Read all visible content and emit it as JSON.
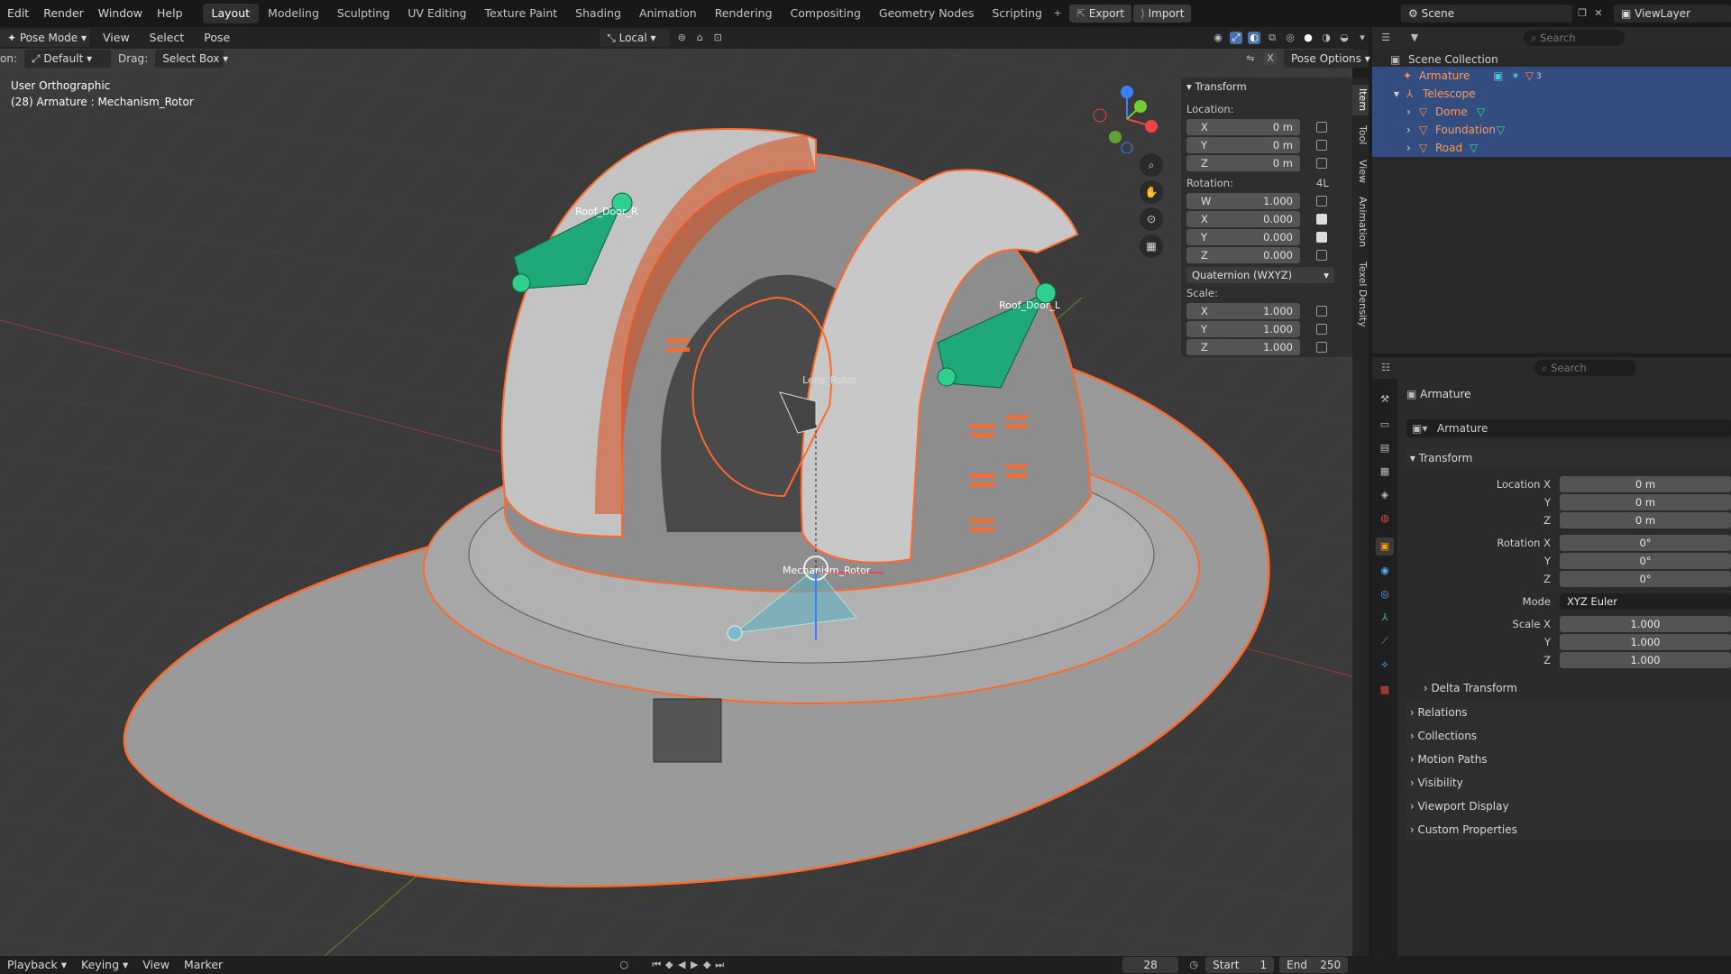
{
  "menubar": {
    "items": [
      "Edit",
      "Render",
      "Window",
      "Help"
    ],
    "workspaces": [
      "Layout",
      "Modeling",
      "Sculpting",
      "UV Editing",
      "Texture Paint",
      "Shading",
      "Animation",
      "Rendering",
      "Compositing",
      "Geometry Nodes",
      "Scripting"
    ],
    "active_workspace": "Layout",
    "export_label": "Export",
    "import_label": "Import",
    "scene_name": "Scene",
    "view_layer": "ViewLayer"
  },
  "viewport_header": {
    "mode": "Pose Mode",
    "menus": [
      "View",
      "Select",
      "Pose"
    ],
    "orientation_prefix": "on:",
    "orientation": "Default",
    "drag_label": "Drag:",
    "drag_value": "Select Box",
    "transform_space": "Local",
    "pose_options": "Pose Options"
  },
  "viewport": {
    "view_name": "User Orthographic",
    "active_info": "(28) Armature : Mechanism_Rotor",
    "bones": [
      "Roof_Door_R",
      "Roof_Door_L",
      "Lens_Rotor",
      "Mechanism_Rotor"
    ]
  },
  "npanel": {
    "title": "Transform",
    "location_label": "Location:",
    "location": [
      {
        "axis": "X",
        "value": "0 m"
      },
      {
        "axis": "Y",
        "value": "0 m"
      },
      {
        "axis": "Z",
        "value": "0 m"
      }
    ],
    "rotation_label": "Rotation:",
    "rotation_badge": "4L",
    "rotation": [
      {
        "axis": "W",
        "value": "1.000"
      },
      {
        "axis": "X",
        "value": "0.000"
      },
      {
        "axis": "Y",
        "value": "0.000"
      },
      {
        "axis": "Z",
        "value": "0.000"
      }
    ],
    "rotation_mode": "Quaternion (WXYZ)",
    "scale_label": "Scale:",
    "scale": [
      {
        "axis": "X",
        "value": "1.000"
      },
      {
        "axis": "Y",
        "value": "1.000"
      },
      {
        "axis": "Z",
        "value": "1.000"
      }
    ],
    "tabs": [
      "Item",
      "Tool",
      "View",
      "Animation",
      "Texel Density"
    ]
  },
  "outliner": {
    "search_placeholder": "Search",
    "root": "Scene Collection",
    "rows": [
      {
        "label": "Armature",
        "indent": 1,
        "selected": true
      },
      {
        "label": "Telescope",
        "indent": 1,
        "selected": true
      },
      {
        "label": "Dome",
        "indent": 2,
        "selected": true
      },
      {
        "label": "Foundation",
        "indent": 2,
        "selected": true
      },
      {
        "label": "Road",
        "indent": 2,
        "selected": true
      }
    ],
    "badge_3": "3"
  },
  "properties": {
    "search_placeholder": "Search",
    "object_name": "Armature",
    "object_field": "Armature",
    "transform_title": "Transform",
    "location_x_label": "Location X",
    "y_label": "Y",
    "z_label": "Z",
    "location": [
      "0 m",
      "0 m",
      "0 m"
    ],
    "rotation_x_label": "Rotation X",
    "rotation": [
      "0°",
      "0°",
      "0°"
    ],
    "mode_label": "Mode",
    "mode_value": "XYZ Euler",
    "scale_x_label": "Scale X",
    "scale": [
      "1.000",
      "1.000",
      "1.000"
    ],
    "delta_transform": "Delta Transform",
    "panels": [
      "Relations",
      "Collections",
      "Motion Paths",
      "Visibility",
      "Viewport Display",
      "Custom Properties"
    ]
  },
  "timeline": {
    "menus": [
      "Playback",
      "Keying",
      "View",
      "Marker"
    ],
    "current_frame": "28",
    "start_label": "Start",
    "start_value": "1",
    "end_label": "End",
    "end_value": "250"
  },
  "colors": {
    "accent_orange": "#ff6a2b",
    "bone_green": "#1fa878",
    "selection_blue": "#334d80",
    "viewport_bg": "#3a3a3a"
  }
}
